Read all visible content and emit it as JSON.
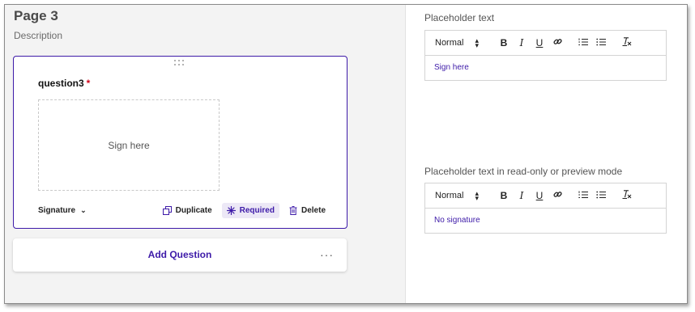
{
  "page": {
    "title": "Page 3",
    "description": "Description"
  },
  "question": {
    "title": "question3",
    "required_mark": "*",
    "signature_placeholder": "Sign here",
    "type_label": "Signature",
    "actions": {
      "duplicate": "Duplicate",
      "required": "Required",
      "delete": "Delete"
    }
  },
  "add_question": {
    "label": "Add Question",
    "more": "···"
  },
  "properties": {
    "placeholder": {
      "label": "Placeholder text",
      "format": "Normal",
      "value": "Sign here"
    },
    "readonly_placeholder": {
      "label": "Placeholder text in read-only or preview mode",
      "format": "Normal",
      "value": "No signature"
    }
  },
  "toolbar_icons": [
    "bold-icon",
    "italic-icon",
    "underline-icon",
    "link-icon",
    "ordered-list-icon",
    "bullet-list-icon",
    "clear-format-icon"
  ],
  "colors": {
    "accent": "#3d1aa8",
    "required": "#d0021b",
    "panel": "#f3f3f3"
  }
}
